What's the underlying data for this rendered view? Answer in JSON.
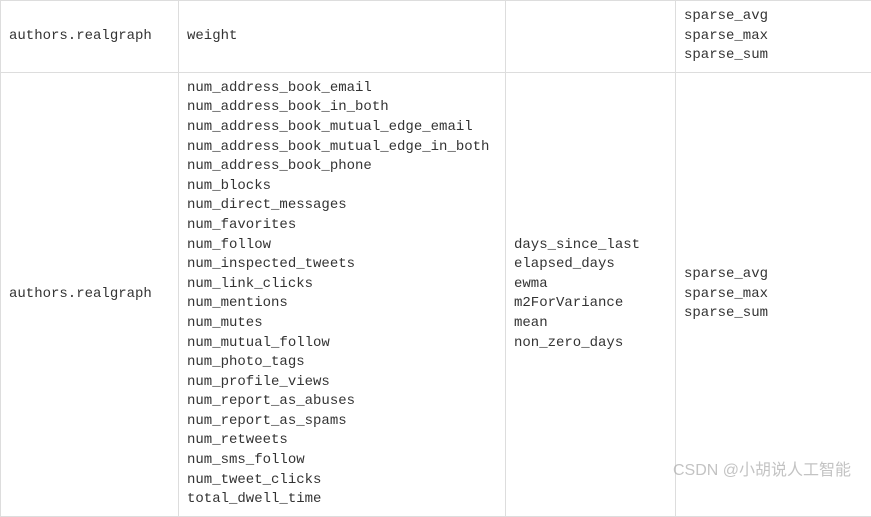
{
  "rows": [
    {
      "col1": [
        "authors.realgraph"
      ],
      "col2": [
        "weight"
      ],
      "col3": [],
      "col4": [
        "sparse_avg",
        "sparse_max",
        "sparse_sum"
      ]
    },
    {
      "col1": [
        "authors.realgraph"
      ],
      "col2": [
        "num_address_book_email",
        "num_address_book_in_both",
        "num_address_book_mutual_edge_email",
        "num_address_book_mutual_edge_in_both",
        "num_address_book_phone",
        "num_blocks",
        "num_direct_messages",
        "num_favorites",
        "num_follow",
        "num_inspected_tweets",
        "num_link_clicks",
        "num_mentions",
        "num_mutes",
        "num_mutual_follow",
        "num_photo_tags",
        "num_profile_views",
        "num_report_as_abuses",
        "num_report_as_spams",
        "num_retweets",
        "num_sms_follow",
        "num_tweet_clicks",
        "total_dwell_time"
      ],
      "col3": [
        "days_since_last",
        "elapsed_days",
        "ewma",
        "m2ForVariance",
        "mean",
        "non_zero_days"
      ],
      "col4": [
        "sparse_avg",
        "sparse_max",
        "sparse_sum"
      ]
    }
  ],
  "watermark": "CSDN @小胡说人工智能"
}
